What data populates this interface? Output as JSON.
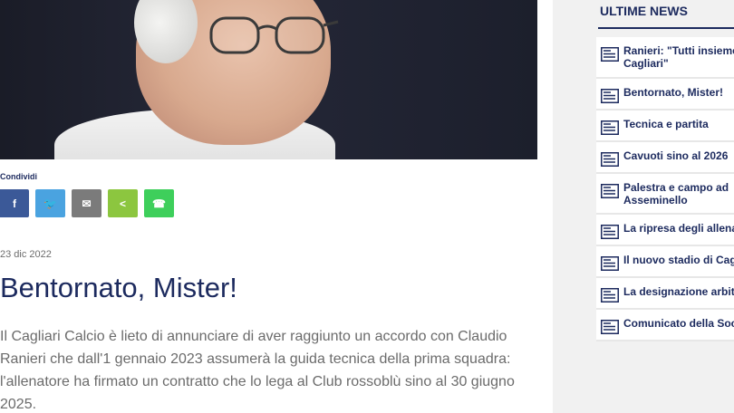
{
  "article": {
    "share_label": "Condividi",
    "share_buttons": [
      {
        "icon": "facebook-icon",
        "glyph": "f",
        "color": "#3b5998"
      },
      {
        "icon": "twitter-icon",
        "glyph": "🐦",
        "color": "#4aa3e0"
      },
      {
        "icon": "email-icon",
        "glyph": "✉",
        "color": "#7b7b7b"
      },
      {
        "icon": "share-icon",
        "glyph": "<",
        "color": "#8cc63f"
      },
      {
        "icon": "whatsapp-icon",
        "glyph": "☎",
        "color": "#3ecf5b"
      }
    ],
    "date": "23 dic 2022",
    "title": "Bentornato, Mister!",
    "body_lines": [
      "Il Cagliari Calcio è lieto di annunciare di aver raggiunto un accordo con Claudio",
      "Ranieri che dall'1 gennaio 2023 assumerà la guida tecnica della prima squadra:",
      "l'allenatore ha firmato un contratto che lo lega al Club rossoblù sino al 30 giugno",
      "2025."
    ]
  },
  "sidebar": {
    "title": "ULTIME NEWS",
    "items": [
      {
        "lines": [
          "Ranieri: \"Tutti insieme",
          "Cagliari\""
        ]
      },
      {
        "lines": [
          "Bentornato, Mister!"
        ]
      },
      {
        "lines": [
          "Tecnica e partita"
        ]
      },
      {
        "lines": [
          "Cavuoti sino al 2026"
        ]
      },
      {
        "lines": [
          "Palestra e campo ad",
          "Asseminello"
        ]
      },
      {
        "lines": [
          "La ripresa degli allena"
        ]
      },
      {
        "lines": [
          "Il nuovo stadio di Cagl"
        ]
      },
      {
        "lines": [
          "La designazione arbitr"
        ]
      },
      {
        "lines": [
          "Comunicato della Soc"
        ]
      }
    ]
  },
  "colors": {
    "brand": "#1c2a5e",
    "body_text": "#6b6b6b"
  }
}
